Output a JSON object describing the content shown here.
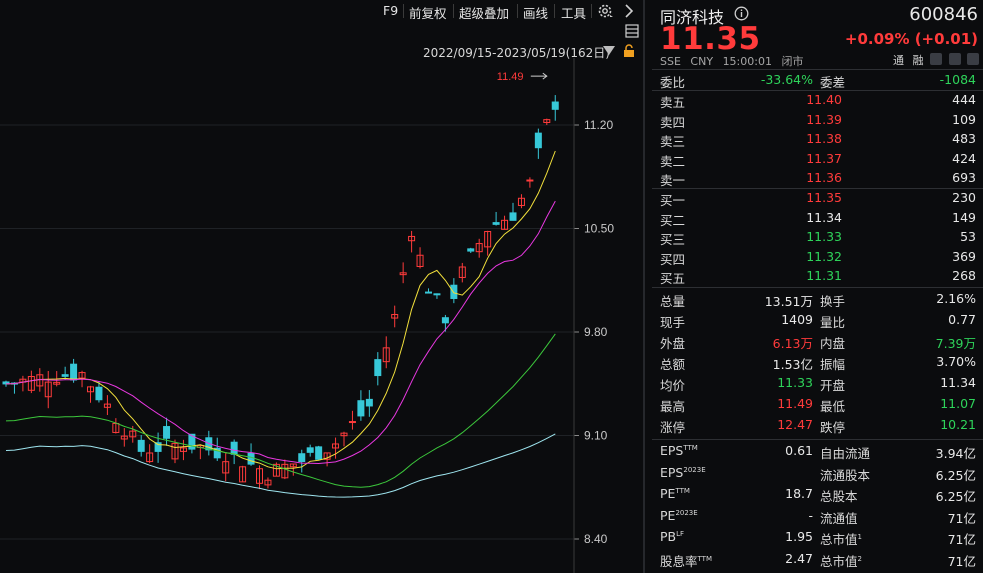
{
  "toolbar": {
    "items": [
      "F9",
      "前复权",
      "超级叠加",
      "画线",
      "工具"
    ],
    "settings_icon": "gear-icon",
    "expand_icon": "chevron-right-icon"
  },
  "chart_header": {
    "date_range": "2022/09/15-2023/05/19(162日)"
  },
  "chart_data": {
    "type": "candlestick",
    "high_marker": "11.49",
    "y_ticks": [
      "11.20",
      "10.50",
      "9.80",
      "9.10",
      "8.40"
    ],
    "ylim": [
      8.4,
      11.6
    ],
    "colors": {
      "up": "#ff3b3b",
      "down": "#37c8d8",
      "ma5": "#ffffff",
      "ma10": "#f2e03c",
      "ma20": "#e838e0",
      "ma60": "#3cc83c",
      "ma120": "#9fe6f0"
    }
  },
  "quote": {
    "name": "同济科技",
    "code": "600846",
    "price": "11.35",
    "change": "+0.09% (+0.01)",
    "exchange": "SSE",
    "currency": "CNY",
    "time": "15:00:01",
    "status": "闭市",
    "tags": [
      "通",
      "融"
    ],
    "order_ratio": {
      "label1": "委比",
      "value1": "-33.64%",
      "label2": "委差",
      "value2": "-1084"
    },
    "asks": [
      {
        "label": "卖五",
        "price": "11.40",
        "vol": "444"
      },
      {
        "label": "卖四",
        "price": "11.39",
        "vol": "109"
      },
      {
        "label": "卖三",
        "price": "11.38",
        "vol": "483"
      },
      {
        "label": "卖二",
        "price": "11.37",
        "vol": "424"
      },
      {
        "label": "卖一",
        "price": "11.36",
        "vol": "693"
      }
    ],
    "bids": [
      {
        "label": "买一",
        "price": "11.35",
        "vol": "230"
      },
      {
        "label": "买二",
        "price": "11.34",
        "vol": "149"
      },
      {
        "label": "买三",
        "price": "11.33",
        "vol": "53"
      },
      {
        "label": "买四",
        "price": "11.32",
        "vol": "369"
      },
      {
        "label": "买五",
        "price": "11.31",
        "vol": "268"
      }
    ],
    "stats": [
      {
        "l1": "总量",
        "v1": "13.51万",
        "l2": "换手",
        "v2": "2.16%"
      },
      {
        "l1": "现手",
        "v1": "1409",
        "l2": "量比",
        "v2": "0.77"
      },
      {
        "l1": "外盘",
        "v1": "6.13万",
        "l2": "内盘",
        "v2": "7.39万"
      },
      {
        "l1": "总额",
        "v1": "1.53亿",
        "l2": "振幅",
        "v2": "3.70%"
      },
      {
        "l1": "均价",
        "v1": "11.33",
        "l2": "开盘",
        "v2": "11.34"
      },
      {
        "l1": "最高",
        "v1": "11.49",
        "l2": "最低",
        "v2": "11.07"
      },
      {
        "l1": "涨停",
        "v1": "12.47",
        "l2": "跌停",
        "v2": "10.21"
      }
    ],
    "fundamentals": [
      {
        "l1": "EPS",
        "s1": "TTM",
        "v1": "0.61",
        "l2": "自由流通",
        "s2": "",
        "v2": "3.94亿"
      },
      {
        "l1": "EPS",
        "s1": "2023E",
        "v1": "",
        "l2": "流通股本",
        "s2": "",
        "v2": "6.25亿"
      },
      {
        "l1": "PE",
        "s1": "TTM",
        "v1": "18.7",
        "l2": "总股本",
        "s2": "",
        "v2": "6.25亿"
      },
      {
        "l1": "PE",
        "s1": "2023E",
        "v1": "-",
        "l2": "流通值",
        "s2": "",
        "v2": "71亿"
      },
      {
        "l1": "PB",
        "s1": "LF",
        "v1": "1.95",
        "l2": "总市值",
        "s2": "1",
        "v2": "71亿"
      },
      {
        "l1": "股息率",
        "s1": "TTM",
        "v1": "2.47",
        "l2": "总市值",
        "s2": "2",
        "v2": "71亿"
      }
    ]
  }
}
